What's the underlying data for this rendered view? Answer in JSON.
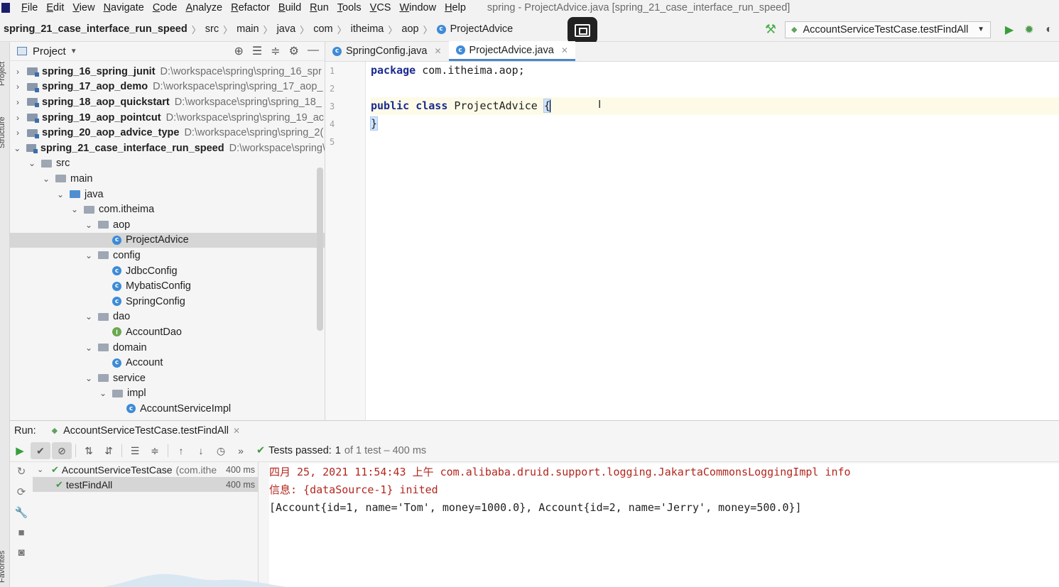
{
  "menu": {
    "items": [
      "File",
      "Edit",
      "View",
      "Navigate",
      "Code",
      "Analyze",
      "Refactor",
      "Build",
      "Run",
      "Tools",
      "VCS",
      "Window",
      "Help"
    ],
    "window_title": "spring - ProjectAdvice.java [spring_21_case_interface_run_speed]"
  },
  "breadcrumb": {
    "items": [
      "spring_21_case_interface_run_speed",
      "src",
      "main",
      "java",
      "com",
      "itheima",
      "aop",
      "ProjectAdvice"
    ]
  },
  "toolbar": {
    "run_config": "AccountServiceTestCase.testFindAll"
  },
  "left_stripe": {
    "project_label": "Project",
    "structure_label": "Structure",
    "favorites_label": "Favorites"
  },
  "project_panel": {
    "title": "Project",
    "tree": [
      {
        "name": "spring_16_spring_junit",
        "path": "D:\\workspace\\spring\\spring_16_spr",
        "depth": 0,
        "arrow": "›",
        "icon": "module",
        "bold": true
      },
      {
        "name": "spring_17_aop_demo",
        "path": "D:\\workspace\\spring\\spring_17_aop_",
        "depth": 0,
        "arrow": "›",
        "icon": "module",
        "bold": true
      },
      {
        "name": "spring_18_aop_quickstart",
        "path": "D:\\workspace\\spring\\spring_18_",
        "depth": 0,
        "arrow": "›",
        "icon": "module",
        "bold": true
      },
      {
        "name": "spring_19_aop_pointcut",
        "path": "D:\\workspace\\spring\\spring_19_ac",
        "depth": 0,
        "arrow": "›",
        "icon": "module",
        "bold": true
      },
      {
        "name": "spring_20_aop_advice_type",
        "path": "D:\\workspace\\spring\\spring_2(",
        "depth": 0,
        "arrow": "›",
        "icon": "module",
        "bold": true
      },
      {
        "name": "spring_21_case_interface_run_speed",
        "path": "D:\\workspace\\spring\\",
        "depth": 0,
        "arrow": "⌄",
        "icon": "module",
        "bold": true
      },
      {
        "name": "src",
        "path": "",
        "depth": 1,
        "arrow": "⌄",
        "icon": "folder",
        "bold": false
      },
      {
        "name": "main",
        "path": "",
        "depth": 2,
        "arrow": "⌄",
        "icon": "folder",
        "bold": false
      },
      {
        "name": "java",
        "path": "",
        "depth": 3,
        "arrow": "⌄",
        "icon": "folder-blue",
        "bold": false
      },
      {
        "name": "com.itheima",
        "path": "",
        "depth": 4,
        "arrow": "⌄",
        "icon": "folder",
        "bold": false
      },
      {
        "name": "aop",
        "path": "",
        "depth": 5,
        "arrow": "⌄",
        "icon": "folder",
        "bold": false
      },
      {
        "name": "ProjectAdvice",
        "path": "",
        "depth": 6,
        "arrow": "",
        "icon": "class",
        "bold": false,
        "selected": true
      },
      {
        "name": "config",
        "path": "",
        "depth": 5,
        "arrow": "⌄",
        "icon": "folder",
        "bold": false
      },
      {
        "name": "JdbcConfig",
        "path": "",
        "depth": 6,
        "arrow": "",
        "icon": "class",
        "bold": false
      },
      {
        "name": "MybatisConfig",
        "path": "",
        "depth": 6,
        "arrow": "",
        "icon": "class",
        "bold": false
      },
      {
        "name": "SpringConfig",
        "path": "",
        "depth": 6,
        "arrow": "",
        "icon": "class",
        "bold": false
      },
      {
        "name": "dao",
        "path": "",
        "depth": 5,
        "arrow": "⌄",
        "icon": "folder",
        "bold": false
      },
      {
        "name": "AccountDao",
        "path": "",
        "depth": 6,
        "arrow": "",
        "icon": "interface",
        "bold": false
      },
      {
        "name": "domain",
        "path": "",
        "depth": 5,
        "arrow": "⌄",
        "icon": "folder",
        "bold": false
      },
      {
        "name": "Account",
        "path": "",
        "depth": 6,
        "arrow": "",
        "icon": "class",
        "bold": false
      },
      {
        "name": "service",
        "path": "",
        "depth": 5,
        "arrow": "⌄",
        "icon": "folder",
        "bold": false
      },
      {
        "name": "impl",
        "path": "",
        "depth": 6,
        "arrow": "⌄",
        "icon": "folder",
        "bold": false
      },
      {
        "name": "AccountServiceImpl",
        "path": "",
        "depth": 7,
        "arrow": "",
        "icon": "class",
        "bold": false
      }
    ]
  },
  "editor": {
    "tabs": [
      {
        "label": "SpringConfig.java",
        "active": false
      },
      {
        "label": "ProjectAdvice.java",
        "active": true
      }
    ],
    "line_numbers": [
      "1",
      "2",
      "3",
      "4",
      "5"
    ],
    "code": {
      "line1_kw": "package",
      "line1_rest": " com.itheima.aop;",
      "line3_kw1": "public",
      "line3_kw2": "class",
      "line3_name": "ProjectAdvice",
      "open_brace": "{",
      "close_brace": "}"
    }
  },
  "run_panel": {
    "label": "Run:",
    "tab": "AccountServiceTestCase.testFindAll",
    "status_prefix": "Tests passed:",
    "status_count": "1",
    "status_of": "of 1 test – 400 ms",
    "tests": [
      {
        "name": "AccountServiceTestCase",
        "sub": "(com.ithe",
        "duration": "400 ms"
      },
      {
        "name": "testFindAll",
        "sub": "",
        "duration": "400 ms"
      }
    ],
    "console": [
      {
        "text": "四月 25, 2021 11:54:43 上午 com.alibaba.druid.support.logging.JakartaCommonsLoggingImpl info",
        "kind": "err"
      },
      {
        "text": "信息: {dataSource-1} inited",
        "kind": "err"
      },
      {
        "text": "[Account{id=1, name='Tom', money=1000.0}, Account{id=2, name='Jerry', money=500.0}]",
        "kind": "out"
      }
    ]
  }
}
